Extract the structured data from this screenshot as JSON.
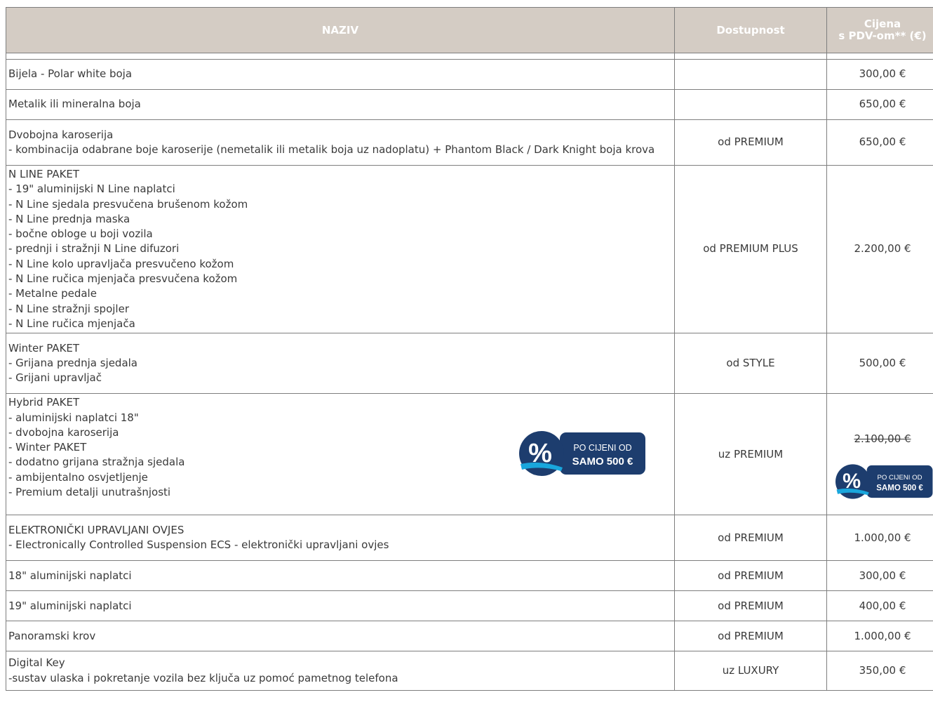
{
  "header": {
    "naziv": "NAZIV",
    "dostupnost": "Dostupnost",
    "cijena_l1": "Cijena",
    "cijena_l2": "s PDV-om** (€)"
  },
  "rows": [
    {
      "lines": [
        "Bijela - Polar white boja"
      ],
      "avail": "",
      "price": "300,00 €"
    },
    {
      "lines": [
        "Metalik ili mineralna boja"
      ],
      "avail": "",
      "price": "650,00 €"
    },
    {
      "lines": [
        "Dvobojna karoserija",
        "- kombinacija odabrane boje karoserije (nemetalik ili metalik boja uz nadoplatu) + Phantom Black / Dark Knight boja krova"
      ],
      "avail": "od PREMIUM",
      "price": "650,00 €"
    },
    {
      "lines": [
        "N LINE PAKET",
        "- 19\" aluminijski N Line naplatci",
        "- N Line sjedala presvučena brušenom kožom",
        "- N Line prednja maska",
        "- bočne obloge u boji vozila",
        "- prednji i stražnji N Line difuzori",
        "- N Line kolo upravljača presvučeno kožom",
        "- N Line ručica mjenjača presvučena kožom",
        "- Metalne pedale",
        "- N Line stražnji spojler",
        "- N Line ručica mjenjača"
      ],
      "avail": "od PREMIUM PLUS",
      "price": "2.200,00 €"
    },
    {
      "lines": [
        "Winter PAKET",
        "- Grijana prednja sjedala",
        "- Grijani upravljač"
      ],
      "avail": "od STYLE",
      "price": "500,00 €"
    },
    {
      "lines": [
        "Hybrid PAKET",
        "- aluminijski naplatci 18\"",
        "- dvobojna karoserija",
        "- Winter PAKET",
        "- dodatno grijana stražnja sjedala",
        "- ambijentalno osvjetljenje",
        "- Premium detalji unutrašnjosti"
      ],
      "avail": "uz PREMIUM",
      "price": "2.100,00 €"
    },
    {
      "lines": [
        "ELEKTRONIČKI UPRAVLJANI OVJES",
        "- Electronically Controlled Suspension ECS - elektronički upravljani ovjes"
      ],
      "avail": "od PREMIUM",
      "price": "1.000,00 €"
    },
    {
      "lines": [
        "18\" aluminijski naplatci"
      ],
      "avail": "od PREMIUM",
      "price": "300,00 €"
    },
    {
      "lines": [
        "19\" aluminijski naplatci"
      ],
      "avail": "od PREMIUM",
      "price": "400,00 €"
    },
    {
      "lines": [
        "Panoramski krov"
      ],
      "avail": "od PREMIUM",
      "price": "1.000,00 €"
    },
    {
      "lines": [
        "Digital Key",
        "-sustav ulaska i pokretanje vozila bez ključa uz pomoć pametnog telefona"
      ],
      "avail": "uz LUXURY",
      "price": "350,00 €"
    }
  ],
  "promo": {
    "symbol": "%",
    "line1": "PO CIJENI OD",
    "line2": "SAMO  500 €"
  },
  "colors": {
    "header_bg": "#d4ccc4",
    "badge_navy": "#1d3d6e",
    "badge_accent": "#19a6dc"
  }
}
